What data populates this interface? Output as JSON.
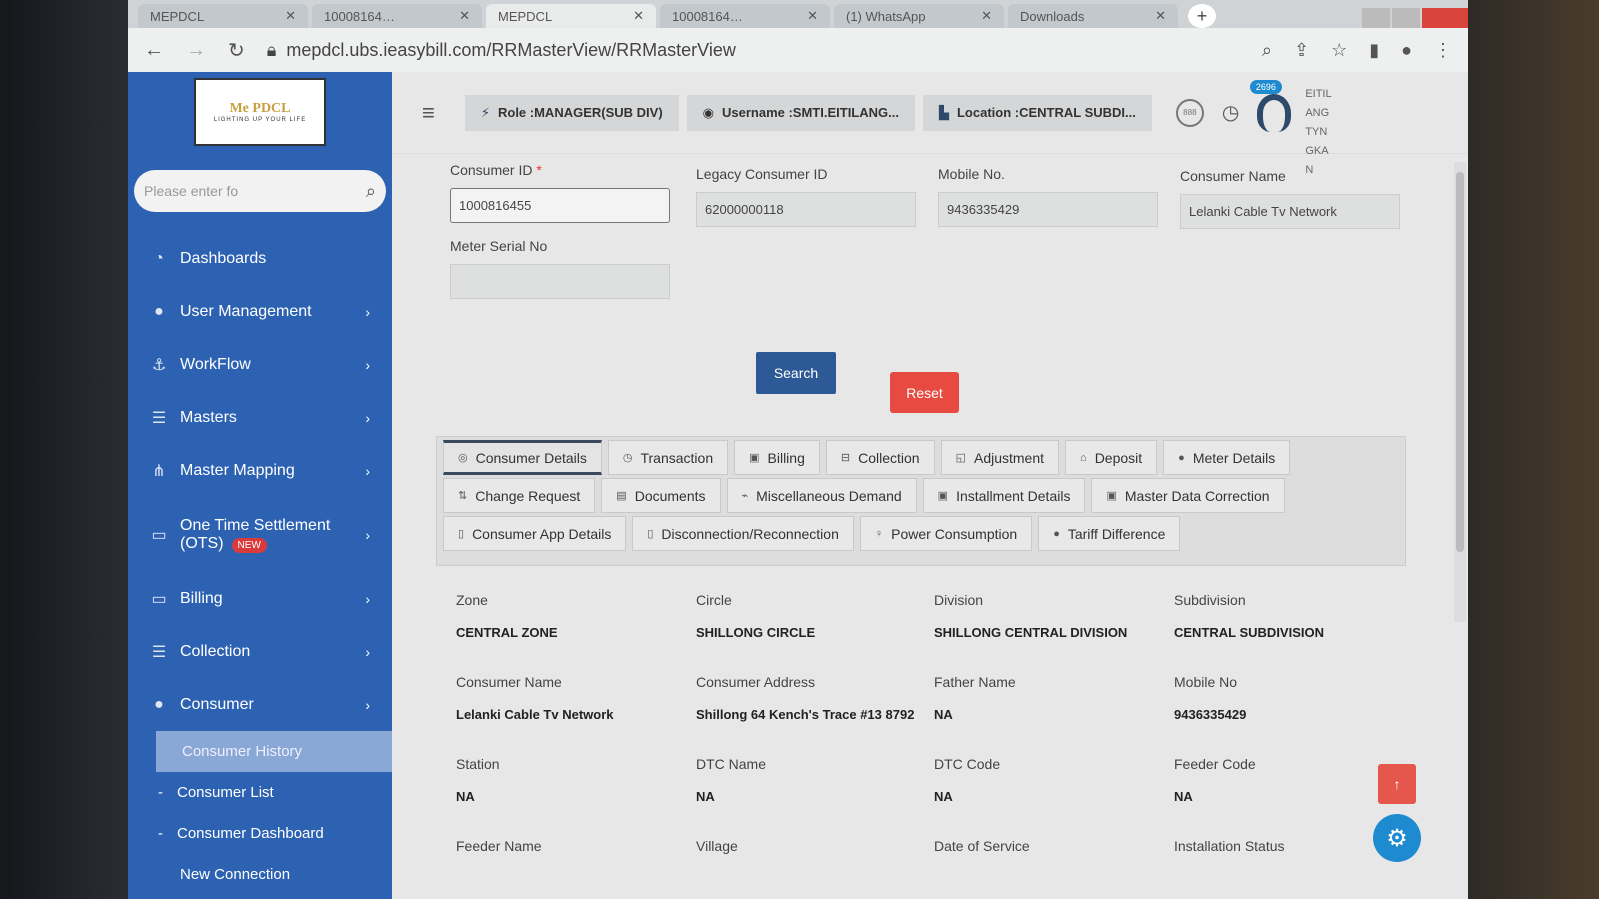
{
  "browser": {
    "tabs": [
      {
        "label": "MEPDCL"
      },
      {
        "label": "10008164…"
      },
      {
        "label": "MEPDCL"
      },
      {
        "label": "10008164…"
      },
      {
        "label": "(1) WhatsApp"
      },
      {
        "label": "Downloads"
      }
    ],
    "url": "mepdcl.ubs.ieasybill.com/RRMasterView/RRMasterView"
  },
  "sidebar": {
    "logo_text": "Me PDCL",
    "logo_tagline": "LIGHTING UP YOUR LIFE",
    "search_placeholder": "Please enter fo",
    "items": [
      {
        "label": "Dashboards",
        "icon": "dashboard-icon"
      },
      {
        "label": "User Management",
        "icon": "user-icon"
      },
      {
        "label": "WorkFlow",
        "icon": "anchor-icon"
      },
      {
        "label": "Masters",
        "icon": "list-icon"
      },
      {
        "label": "Master Mapping",
        "icon": "sitemap-icon"
      },
      {
        "label": "One Time Settlement (OTS)",
        "icon": "monitor-icon",
        "badge": "NEW"
      },
      {
        "label": "Billing",
        "icon": "monitor-icon"
      },
      {
        "label": "Collection",
        "icon": "list-icon"
      },
      {
        "label": "Consumer",
        "icon": "user-icon"
      }
    ],
    "sub_items": [
      {
        "label": "Consumer History"
      },
      {
        "label": "Consumer List"
      },
      {
        "label": "Consumer Dashboard"
      },
      {
        "label": "New Connection"
      }
    ]
  },
  "header": {
    "role": "Role :MANAGER(SUB DIV)",
    "username": "Username :SMTI.EITILANG...",
    "location": "Location :CENTRAL SUBDI...",
    "badge_888": "888",
    "notification_count": "2696",
    "user_name_lines": [
      "EITIL",
      "ANG",
      "TYN",
      "GKA",
      "N"
    ]
  },
  "form": {
    "consumer_id_label": "Consumer ID",
    "consumer_id_value": "1000816455",
    "legacy_label": "Legacy Consumer ID",
    "legacy_value": "62000000118",
    "mobile_label": "Mobile No.",
    "mobile_value": "9436335429",
    "name_label": "Consumer Name",
    "name_value": "Lelanki Cable Tv Network",
    "meter_label": "Meter Serial No",
    "meter_value": "",
    "search_label": "Search",
    "reset_label": "Reset"
  },
  "tabs": [
    [
      {
        "label": "Consumer Details",
        "icon": "◎"
      },
      {
        "label": "Transaction",
        "icon": "◷"
      },
      {
        "label": "Billing",
        "icon": "▣"
      },
      {
        "label": "Collection",
        "icon": "⊟"
      },
      {
        "label": "Adjustment",
        "icon": "◱"
      },
      {
        "label": "Deposit",
        "icon": "⌂"
      },
      {
        "label": "Meter Details",
        "icon": "●"
      }
    ],
    [
      {
        "label": "Change Request",
        "icon": "⇅"
      },
      {
        "label": "Documents",
        "icon": "▤"
      },
      {
        "label": "Miscellaneous Demand",
        "icon": "⌁"
      },
      {
        "label": "Installment Details",
        "icon": "▣"
      },
      {
        "label": "Master Data Correction",
        "icon": "▣"
      }
    ],
    [
      {
        "label": "Consumer App Details",
        "icon": "▯"
      },
      {
        "label": "Disconnection/Reconnection",
        "icon": "▯"
      },
      {
        "label": "Power Consumption",
        "icon": "♀"
      },
      {
        "label": "Tariff Difference",
        "icon": "●"
      }
    ]
  ],
  "details": [
    [
      {
        "label": "Zone",
        "value": "CENTRAL ZONE"
      },
      {
        "label": "Circle",
        "value": "SHILLONG CIRCLE"
      },
      {
        "label": "Division",
        "value": "SHILLONG CENTRAL DIVISION"
      },
      {
        "label": "Subdivision",
        "value": "CENTRAL SUBDIVISION"
      }
    ],
    [
      {
        "label": "Consumer Name",
        "value": "Lelanki Cable Tv Network"
      },
      {
        "label": "Consumer Address",
        "value": "Shillong 64 Kench's Trace #13 8792"
      },
      {
        "label": "Father Name",
        "value": "NA"
      },
      {
        "label": "Mobile No",
        "value": "9436335429"
      }
    ],
    [
      {
        "label": "Station",
        "value": "NA"
      },
      {
        "label": "DTC Name",
        "value": "NA"
      },
      {
        "label": "DTC Code",
        "value": "NA"
      },
      {
        "label": "Feeder Code",
        "value": "NA"
      }
    ],
    [
      {
        "label": "Feeder Name",
        "value": ""
      },
      {
        "label": "Village",
        "value": ""
      },
      {
        "label": "Date of Service",
        "value": ""
      },
      {
        "label": "Installation Status",
        "value": ""
      }
    ]
  ],
  "colors": {
    "sidebar": "#2d62b3",
    "primary_button": "#2d5a96",
    "reset_button": "#e64a40",
    "notification": "#1e8ad0"
  }
}
